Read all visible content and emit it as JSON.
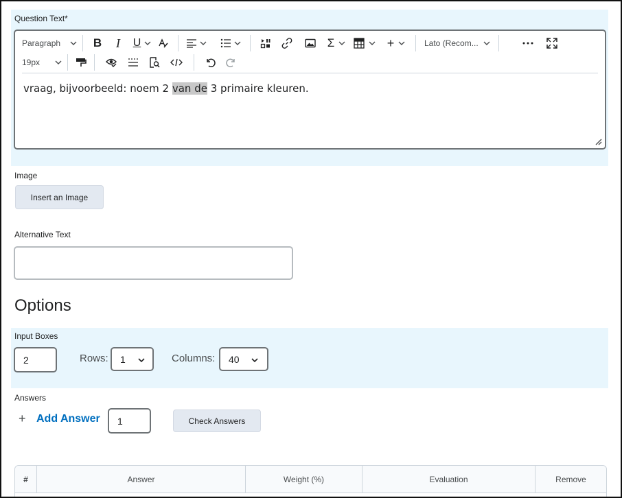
{
  "question": {
    "label": "Question Text",
    "required_mark": "*",
    "toolbar": {
      "paragraph_format": "Paragraph",
      "font_size": "19px",
      "font_family": "Lato (Recom..."
    },
    "content": {
      "before": "vraag, bijvoorbeeld: noem 2 ",
      "highlighted": "van de",
      "after": " 3 primaire kleuren."
    }
  },
  "image": {
    "label": "Image",
    "insert_button": "Insert an Image"
  },
  "alt_text": {
    "label": "Alternative Text",
    "value": ""
  },
  "options": {
    "title": "Options",
    "input_boxes": {
      "label": "Input Boxes",
      "value": "2",
      "rows_label": "Rows:",
      "rows_value": "1",
      "columns_label": "Columns:",
      "columns_value": "40"
    }
  },
  "answers": {
    "label": "Answers",
    "add_answer": "Add Answer",
    "add_icon": "+",
    "count_value": "1",
    "check_button": "Check Answers",
    "table_headers": [
      "#",
      "Answer",
      "Weight (%)",
      "Evaluation",
      "Remove"
    ]
  },
  "colors": {
    "accent_link": "#006fbf",
    "section_bg": "#e8f6fd",
    "button_bg": "#e3e9f1"
  }
}
